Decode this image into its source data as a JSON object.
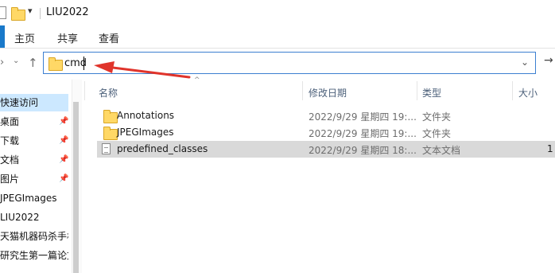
{
  "window": {
    "title": "LIU2022"
  },
  "ribbon": {
    "tabs": [
      "主页",
      "共享",
      "查看"
    ]
  },
  "address": {
    "value": "cmd"
  },
  "sidebar": {
    "items": [
      {
        "label": "快速访问",
        "pinned": false,
        "selected": true
      },
      {
        "label": "桌面",
        "pinned": true
      },
      {
        "label": "下载",
        "pinned": true
      },
      {
        "label": "文档",
        "pinned": true
      },
      {
        "label": "图片",
        "pinned": true
      },
      {
        "label": "JPEGImages",
        "pinned": false
      },
      {
        "label": "LIU2022",
        "pinned": false
      },
      {
        "label": "天猫机器码杀手机",
        "pinned": false
      },
      {
        "label": "研究生第一篇论文",
        "pinned": false
      }
    ]
  },
  "columns": {
    "name": "名称",
    "date": "修改日期",
    "type": "类型",
    "size": "大小"
  },
  "files": [
    {
      "name": "Annotations",
      "date": "2022/9/29 星期四 19:...",
      "type": "文件夹",
      "size": "",
      "icon": "folder-icon"
    },
    {
      "name": "JPEGImages",
      "date": "2022/9/29 星期四 19:...",
      "type": "文件夹",
      "size": "",
      "icon": "folder-icon"
    },
    {
      "name": "predefined_classes",
      "date": "2022/9/29 星期四 18:...",
      "type": "文本文档",
      "size": "1",
      "icon": "text-file-icon"
    }
  ],
  "colors": {
    "accent": "#1979ca",
    "selection": "#cce8ff",
    "row_highlight": "#d9d9d9",
    "annotation": "#e0342b"
  }
}
